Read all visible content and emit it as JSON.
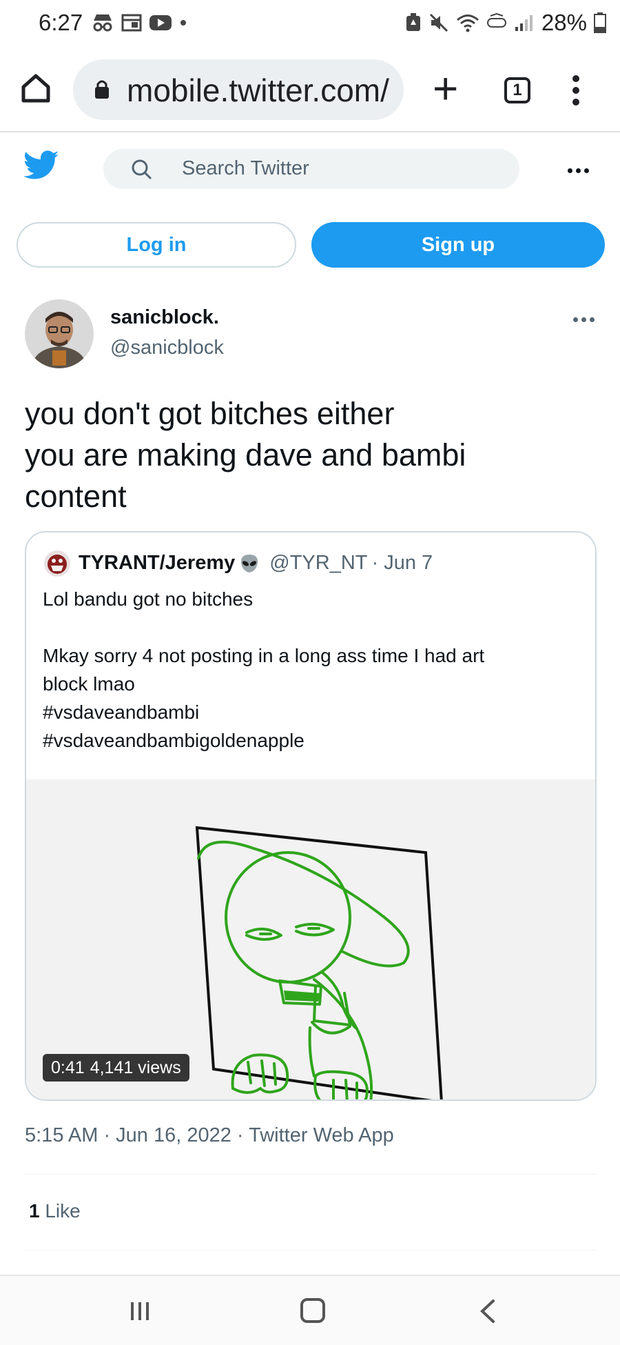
{
  "status_bar": {
    "time": "6:27",
    "battery_percent": "28%"
  },
  "browser": {
    "url": "mobile.twitter.com/",
    "tab_count": "1"
  },
  "header": {
    "search_placeholder": "Search Twitter"
  },
  "auth": {
    "login_label": "Log in",
    "signup_label": "Sign up"
  },
  "tweet": {
    "author_name": "sanicblock.",
    "author_handle": "@sanicblock",
    "text_lines": [
      "you don't got bitches either",
      "you are making dave and bambi",
      "content"
    ],
    "timestamp": "5:15 AM · Jun 16, 2022 · Twitter Web App",
    "like_count": "1",
    "like_label": "Like"
  },
  "quoted_tweet": {
    "author_name": "TYRANT/Jeremy",
    "author_handle": "@TYR_NT",
    "date": "· Jun 7",
    "body_lines": [
      "Lol bandu got no bitches",
      "",
      "Mkay sorry 4 not posting in a long ass time I had art",
      "block lmao",
      "#vsdaveandbambi",
      "#vsdaveandbambigoldenapple"
    ],
    "video_duration": "0:41",
    "video_views": "4,141 views"
  },
  "colors": {
    "twitter_blue": "#1d9bf0",
    "drawing_green": "#2fa51c"
  }
}
